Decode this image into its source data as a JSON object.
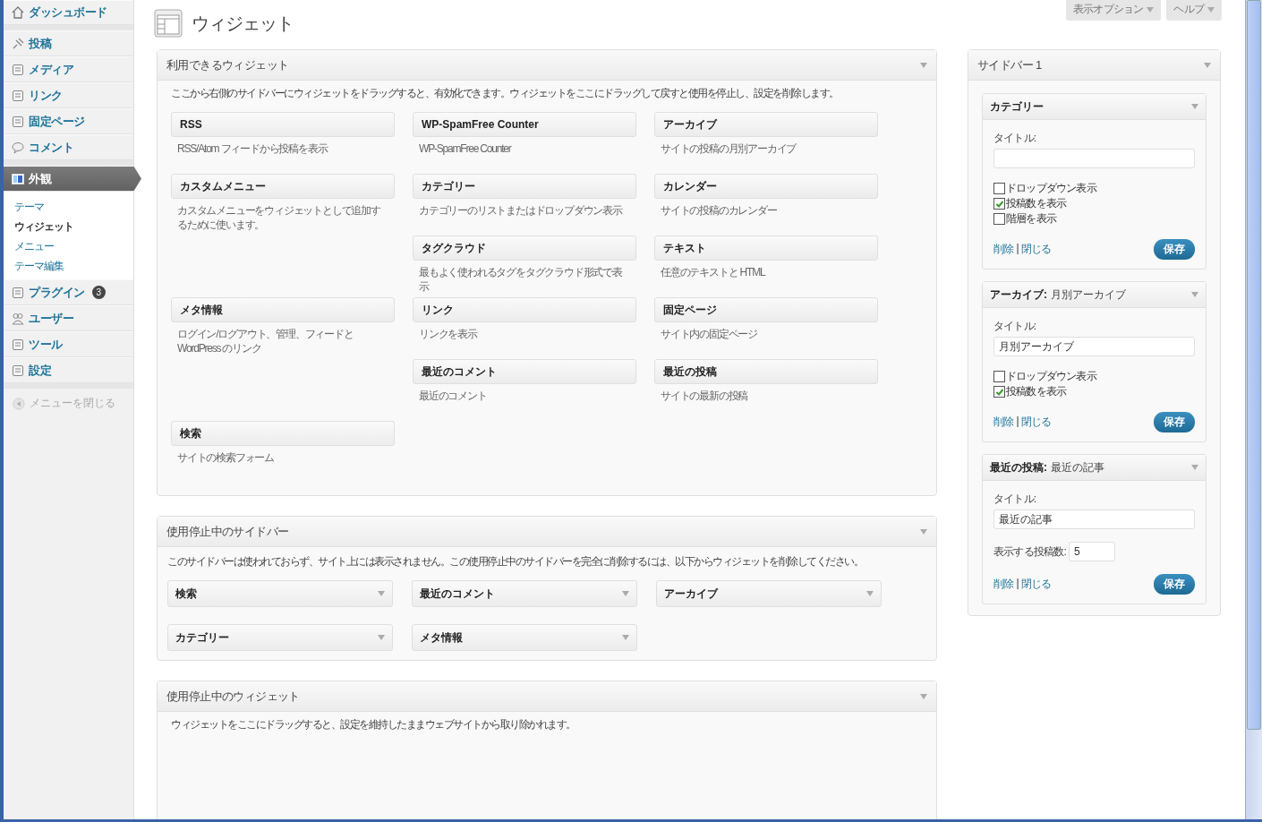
{
  "admin_menu": {
    "groups": [
      [
        {
          "label": "ダッシュボード",
          "selected": false
        }
      ],
      [
        {
          "label": "投稿",
          "selected": false
        },
        {
          "label": "メディア",
          "selected": false
        },
        {
          "label": "リンク",
          "selected": false
        },
        {
          "label": "固定ページ",
          "selected": false
        },
        {
          "label": "コメント",
          "selected": false
        }
      ],
      [
        {
          "label": "外観",
          "selected": true,
          "children": [
            {
              "label": "テーマ",
              "selected": false
            },
            {
              "label": "ウィジェット",
              "selected": true
            },
            {
              "label": "メニュー",
              "selected": false
            },
            {
              "label": "テーマ編集",
              "selected": false
            }
          ]
        },
        {
          "label": "プラグイン",
          "selected": false,
          "badge": "3"
        },
        {
          "label": "ユーザー",
          "selected": false
        },
        {
          "label": "ツール",
          "selected": false
        },
        {
          "label": "設定",
          "selected": false
        }
      ]
    ],
    "collapse": "メニューを閉じる"
  },
  "screen_meta": [
    "表示オプション",
    "ヘルプ"
  ],
  "page_title": "ウィジェット",
  "available_widgets": {
    "title": "利用できるウィジェット",
    "description": "ここから右側のサイドバーにウィジェットをドラッグすると、有効化できます。ウィジェットをここにドラッグして戻すと使用を停止し、設定を削除します。",
    "widgets": [
      {
        "name": "RSS",
        "description": "RSS/Atom フィードから投稿を表示"
      },
      {
        "name": "WP-SpamFree Counter",
        "description": "WP-SpamFree Counter"
      },
      {
        "name": "アーカイブ",
        "description": "サイトの投稿の月別アーカイブ"
      },
      {
        "name": "カスタムメニュー",
        "description": "カスタムメニューをウィジェットとして追加するために使います。"
      },
      {
        "name": "カテゴリー",
        "description": "カテゴリーのリストまたはドロップダウン表示"
      },
      {
        "name": "カレンダー",
        "description": "サイトの投稿のカレンダー"
      },
      {
        "name": "タグクラウド",
        "description": "最もよく使われるタグをタグクラウド形式で表示"
      },
      {
        "name": "テキスト",
        "description": "任意のテキストと HTML"
      },
      {
        "name": "メタ情報",
        "description": "ログイン/ログアウト、管理、フィードと WordPress のリンク"
      },
      {
        "name": "リンク",
        "description": "リンクを表示"
      },
      {
        "name": "固定ページ",
        "description": "サイト内の固定ページ"
      },
      {
        "name": "最近のコメント",
        "description": "最近のコメント"
      },
      {
        "name": "最近の投稿",
        "description": "サイトの最新の投稿"
      },
      {
        "name": "検索",
        "description": "サイトの検索フォーム"
      }
    ]
  },
  "inactive_sidebar": {
    "title": "使用停止中のサイドバー",
    "description": "このサイドバーは使われておらず、サイト上には表示されません。この使用停止中のサイドバーを完全に削除するには、以下からウィジェットを削除してください。",
    "widgets": [
      "検索",
      "最近のコメント",
      "アーカイブ",
      "カテゴリー",
      "メタ情報"
    ]
  },
  "inactive_widgets": {
    "title": "使用停止中のウィジェット",
    "description": "ウィジェットをここにドラッグすると、設定を維持したままウェブサイトから取り除かれます。"
  },
  "sidebar": {
    "title": "サイドバー 1",
    "widgets": [
      {
        "title": "カテゴリー",
        "fields": [
          {
            "kind": "text",
            "label": "タイトル:"
          },
          {
            "kind": "checkbox",
            "label": "ドロップダウン表示",
            "checked": false
          },
          {
            "kind": "checkbox",
            "label": "投稿数を表示",
            "checked": true
          },
          {
            "kind": "checkbox",
            "label": "階層を表示",
            "checked": false
          }
        ],
        "links": [
          "削除",
          "閉じる"
        ],
        "separator": "|",
        "save": "保存"
      },
      {
        "title": "アーカイブ:",
        "subtitle": "月別アーカイブ",
        "fields": [
          {
            "kind": "text",
            "label": "タイトル:",
            "value": "月別アーカイブ"
          },
          {
            "kind": "checkbox",
            "label": "ドロップダウン表示",
            "checked": false
          },
          {
            "kind": "checkbox",
            "label": "投稿数を表示",
            "checked": true
          }
        ],
        "links": [
          "削除",
          "閉じる"
        ],
        "separator": "|",
        "save": "保存"
      },
      {
        "title": "最近の投稿:",
        "subtitle": "最近の記事",
        "fields": [
          {
            "kind": "text",
            "label": "タイトル:",
            "value": "最近の記事"
          },
          {
            "kind": "number",
            "label": "表示する投稿数:",
            "value": "5"
          }
        ],
        "links": [
          "削除",
          "閉じる"
        ],
        "separator": "|",
        "save": "保存"
      }
    ]
  }
}
